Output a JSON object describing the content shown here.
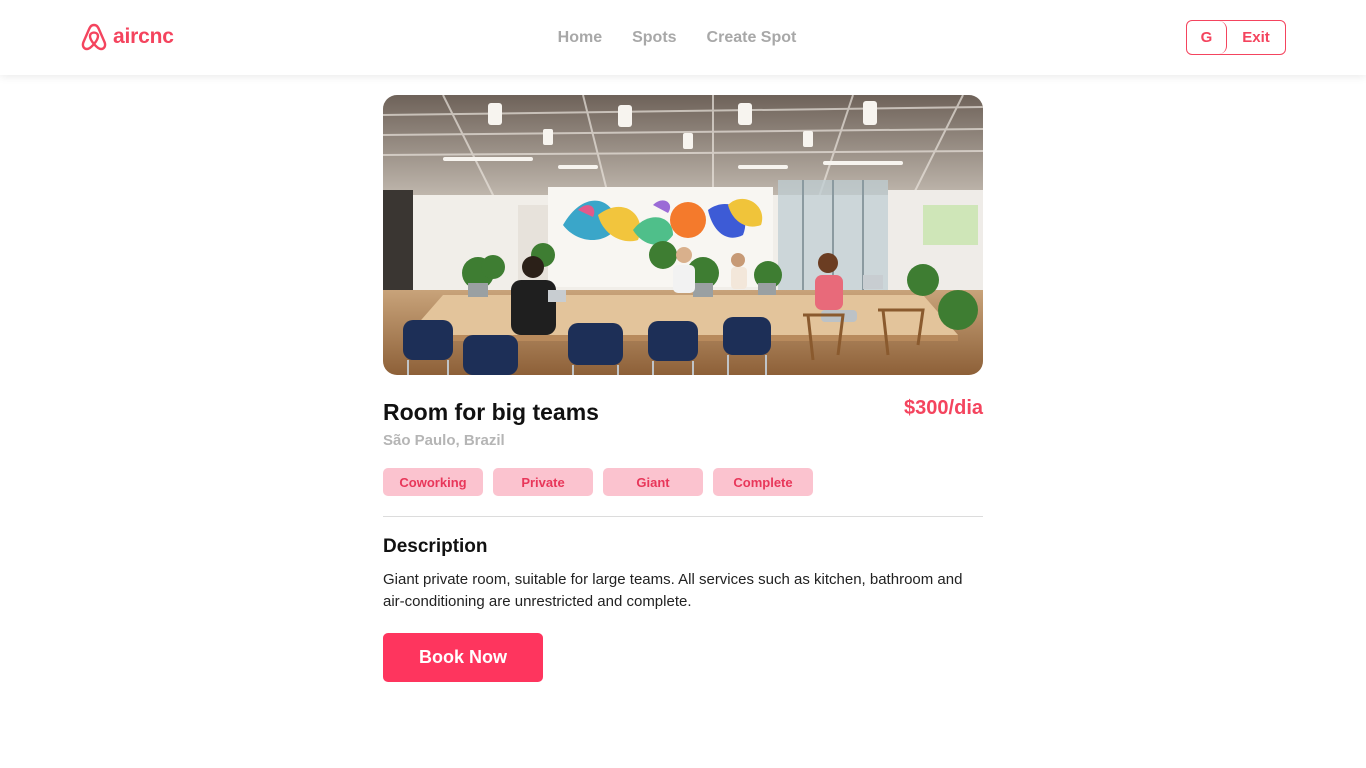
{
  "brand": {
    "name": "aircnc",
    "accent": "#f4445e",
    "logo_icon": "airbnb-logo-icon"
  },
  "nav": {
    "items": [
      {
        "label": "Home"
      },
      {
        "label": "Spots"
      },
      {
        "label": "Create Spot"
      }
    ]
  },
  "user": {
    "initial": "G",
    "exit_label": "Exit"
  },
  "spot": {
    "title": "Room for big teams",
    "price": "$300/dia",
    "location": "São Paulo, Brazil",
    "tags": [
      {
        "label": "Coworking"
      },
      {
        "label": "Private"
      },
      {
        "label": "Giant"
      },
      {
        "label": "Complete"
      }
    ],
    "description_title": "Description",
    "description": "Giant private room, suitable for large teams. All services such as kitchen, bathroom and air-conditioning are unrestricted and complete.",
    "book_label": "Book Now"
  },
  "colors": {
    "tag_bg": "#fbc3cf",
    "tag_text": "#e8375a",
    "button_bg": "#fe355e",
    "muted": "#a8a8a8"
  }
}
